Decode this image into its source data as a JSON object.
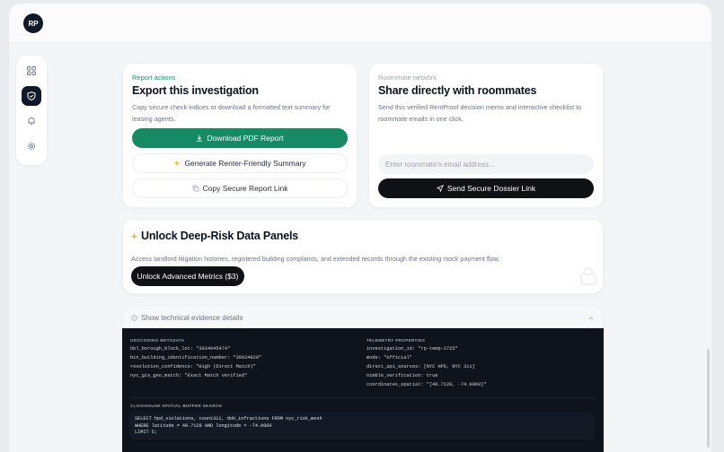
{
  "user": {
    "initials": "RP"
  },
  "sidebar": {
    "items": [
      {
        "name": "grid-icon",
        "active": false
      },
      {
        "name": "shield-icon",
        "active": true
      },
      {
        "name": "bell-icon",
        "active": false
      },
      {
        "name": "gear-icon",
        "active": false
      }
    ]
  },
  "report": {
    "eyebrow": "Report actions",
    "title": "Export this investigation",
    "description": "Copy secure check indices or download a formatted text summary for leasing agents.",
    "download_label": "Download PDF Report",
    "summary_label": "Generate Renter-Friendly Summary",
    "copy_label": "Copy Secure Report Link"
  },
  "roommates": {
    "eyebrow": "Roommate network",
    "title": "Share directly with roommates",
    "description": "Send this verified RentProof decision memo and interactive checklist to roommate emails in one click.",
    "email_placeholder": "Enter roommate's email address...",
    "send_label": "Send Secure Dossier Link"
  },
  "unlock": {
    "title": "Unlock Deep-Risk Data Panels",
    "description": "Access landlord litigation histories, registered building complaints, and extended records through the existing mock payment flow.",
    "button_label": "Unlock Advanced Metrics ($3)"
  },
  "evidence": {
    "toggle_label": "Show technical evidence details",
    "geocoding": {
      "heading": "GEOCODING METADATA",
      "lines": [
        "bbl_borough_block_lot: \"3034945474\"",
        "bin_building_identification_number: \"39634820\"",
        "resolution_confidence: \"High (Direct Match)\"",
        "nyc_gis_geo_match: \"Exact Match verified\""
      ]
    },
    "telemetry": {
      "heading": "TELEMETRY PROPERTIES",
      "lines": [
        "investigation_id: \"rp-temp-2725\"",
        "mode: \"official\"",
        "direct_api_sources: [NYC HPD, NYC 311]",
        "nimble_verification: true",
        "coordinates_spatial: \"[40.7128, -74.0060]\""
      ]
    },
    "sql": {
      "heading": "CLICKHOUSE SPATIAL BUFFER SEARCH",
      "lines": [
        "SELECT hpd_violations, count311, dob_infractions FROM nyc_risk_mesh",
        "WHERE latitude = 40.7128 AND longitude = -74.0060",
        "LIMIT 5;"
      ]
    }
  }
}
